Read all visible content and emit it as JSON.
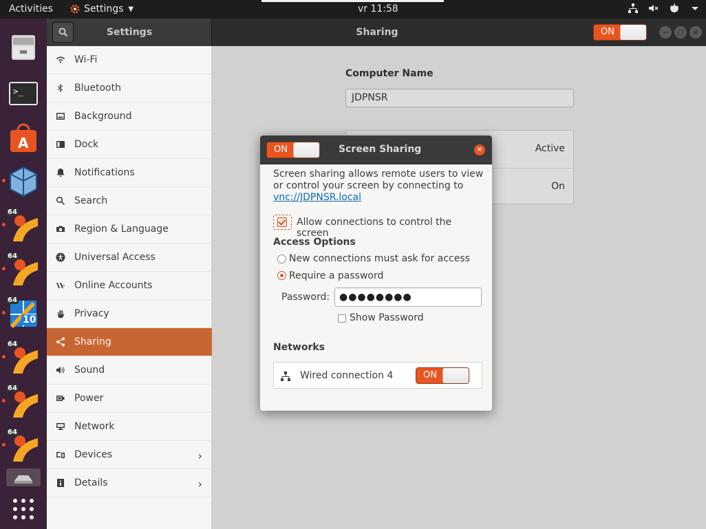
{
  "topbar": {
    "activities": "Activities",
    "app_menu": "Settings",
    "clock": "vr 11:58"
  },
  "dock": {
    "badge": "64",
    "badge_win": "10"
  },
  "header": {
    "left_title": "Settings",
    "title": "Sharing",
    "switch_label": "ON"
  },
  "sidebar": {
    "items": [
      {
        "label": "Wi-Fi",
        "icon": "wifi-icon"
      },
      {
        "label": "Bluetooth",
        "icon": "bluetooth-icon"
      },
      {
        "label": "Background",
        "icon": "background-icon"
      },
      {
        "label": "Dock",
        "icon": "dock-icon"
      },
      {
        "label": "Notifications",
        "icon": "bell-icon"
      },
      {
        "label": "Search",
        "icon": "search-icon"
      },
      {
        "label": "Region & Language",
        "icon": "camera-icon"
      },
      {
        "label": "Universal Access",
        "icon": "accessibility-icon"
      },
      {
        "label": "Online Accounts",
        "icon": "accounts-icon"
      },
      {
        "label": "Privacy",
        "icon": "hand-icon"
      },
      {
        "label": "Sharing",
        "icon": "share-icon"
      },
      {
        "label": "Sound",
        "icon": "speaker-icon"
      },
      {
        "label": "Power",
        "icon": "power-icon"
      },
      {
        "label": "Network",
        "icon": "network-icon"
      },
      {
        "label": "Devices",
        "icon": "devices-icon"
      },
      {
        "label": "Details",
        "icon": "info-icon"
      }
    ],
    "active": "Sharing"
  },
  "main": {
    "computer_name_title": "Computer Name",
    "computer_name_value": "JDPNSR",
    "rows": [
      {
        "value": "Active"
      },
      {
        "value": "On"
      }
    ]
  },
  "dialog": {
    "switch_label": "ON",
    "title": "Screen Sharing",
    "description_text": "Screen sharing allows remote users to view or control your screen by connecting to ",
    "description_link": "vnc://JDPNSR.local",
    "allow_label": "Allow connections to control the screen",
    "access_title": "Access Options",
    "radio_ask": "New connections must ask for access",
    "radio_password": "Require a password",
    "password_label": "Password:",
    "password_value": "●●●●●●●●",
    "show_password": "Show Password",
    "networks_title": "Networks",
    "network_name": "Wired connection 4",
    "network_switch_label": "ON"
  },
  "colors": {
    "accent": "#e95420",
    "sidebar_active": "#c86633",
    "dock_bg": "#3a2238"
  }
}
